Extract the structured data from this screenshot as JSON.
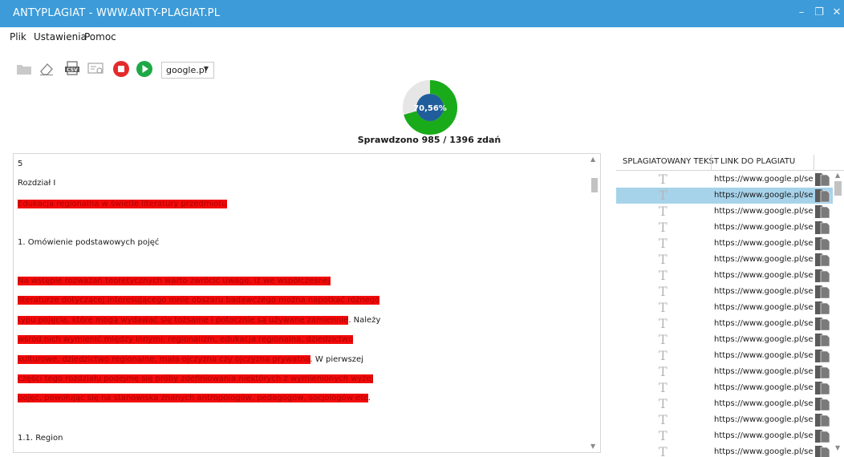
{
  "window": {
    "title": "ANTYPLAGIAT - WWW.ANTY-PLAGIAT.PL"
  },
  "menu": [
    "Plik",
    "Ustawienia",
    "Pomoc"
  ],
  "toolbar": {
    "icons": [
      "folder-icon",
      "eraser-icon",
      "csv-export-icon",
      "certificate-icon",
      "stop-icon",
      "play-icon"
    ],
    "engine": "google.pl"
  },
  "progress": {
    "percent_label": "70,56%",
    "fraction": 0.7056,
    "status": "Sprawdzono 985 / 1396 zdań",
    "color_done": "#1aab1a",
    "color_center": "#1f5e9a"
  },
  "document": {
    "highlight_color": "#f20b0b",
    "lines": [
      {
        "segments": [
          {
            "text": "5",
            "hl": false
          }
        ]
      },
      {
        "segments": [
          {
            "text": "Rozdział I",
            "hl": false
          }
        ]
      },
      {
        "segments": [
          {
            "text": "Edukacja regionalna w świetle literatury przedmiotu",
            "hl": true
          }
        ]
      },
      {
        "segments": [
          {
            "text": "1.  Omówienie podstawowych pojęć",
            "hl": false
          }
        ]
      },
      {
        "segments": [
          {
            "text": "Na wstępie rozważań teoretycznych warto zwrócić uwagę, iż we współczesnej",
            "hl": true
          }
        ]
      },
      {
        "segments": [
          {
            "text": "literaturze dotyczącej interesującego mnie obszaru badawczego można napotkać różnego",
            "hl": true
          }
        ]
      },
      {
        "segments": [
          {
            "text": "typu pojęcia, które mogą wydawać się tożsame i potocznie są używane zamiennie",
            "hl": true
          },
          {
            "text": ". Należy",
            "hl": false
          }
        ]
      },
      {
        "segments": [
          {
            "text": "wśród nich wymienić między innymi: regionalizm, edukacja regionalna, dziedzictwo",
            "hl": true
          }
        ]
      },
      {
        "segments": [
          {
            "text": "kulturowe, dziedzictwo regionalne, mała ojczyzna czy ojczyzna prywatna",
            "hl": true
          },
          {
            "text": ". W pierwszej",
            "hl": false
          }
        ]
      },
      {
        "segments": [
          {
            "text": "części tego rozdziału podejmę się próby zdefiniowania niektórych z wymienionych wyżej",
            "hl": true
          }
        ]
      },
      {
        "segments": [
          {
            "text": "pojęć, powołując się na stanowiska znanych antropologów, pedagogów, socjologów etc",
            "hl": true
          },
          {
            "text": ".",
            "hl": false
          }
        ]
      },
      {
        "segments": [
          {
            "text": "1.1. Region",
            "hl": false
          }
        ]
      }
    ]
  },
  "results": {
    "headers": [
      "SPLAGIATOWANY TEKST",
      "LINK DO PLAGIATU"
    ],
    "selected_index": 1,
    "selected_color": "#a7d3ea",
    "rows": [
      {
        "icon": "text-icon",
        "link": "https://www.google.pl/search?"
      },
      {
        "icon": "text-icon",
        "link": "https://www.google.pl/search?"
      },
      {
        "icon": "text-icon",
        "link": "https://www.google.pl/search?"
      },
      {
        "icon": "text-icon",
        "link": "https://www.google.pl/search?"
      },
      {
        "icon": "text-icon",
        "link": "https://www.google.pl/search?"
      },
      {
        "icon": "text-icon",
        "link": "https://www.google.pl/search?"
      },
      {
        "icon": "text-icon",
        "link": "https://www.google.pl/search?"
      },
      {
        "icon": "text-icon",
        "link": "https://www.google.pl/search?"
      },
      {
        "icon": "text-icon",
        "link": "https://www.google.pl/search?"
      },
      {
        "icon": "text-icon",
        "link": "https://www.google.pl/search?"
      },
      {
        "icon": "text-icon",
        "link": "https://www.google.pl/search?"
      },
      {
        "icon": "text-icon",
        "link": "https://www.google.pl/search?"
      },
      {
        "icon": "text-icon",
        "link": "https://www.google.pl/search?"
      },
      {
        "icon": "text-icon",
        "link": "https://www.google.pl/search?"
      },
      {
        "icon": "text-icon",
        "link": "https://www.google.pl/search?"
      },
      {
        "icon": "text-icon",
        "link": "https://www.google.pl/search?"
      },
      {
        "icon": "text-icon",
        "link": "https://www.google.pl/search?"
      },
      {
        "icon": "text-icon",
        "link": "https://www.google.pl/search?"
      }
    ]
  }
}
